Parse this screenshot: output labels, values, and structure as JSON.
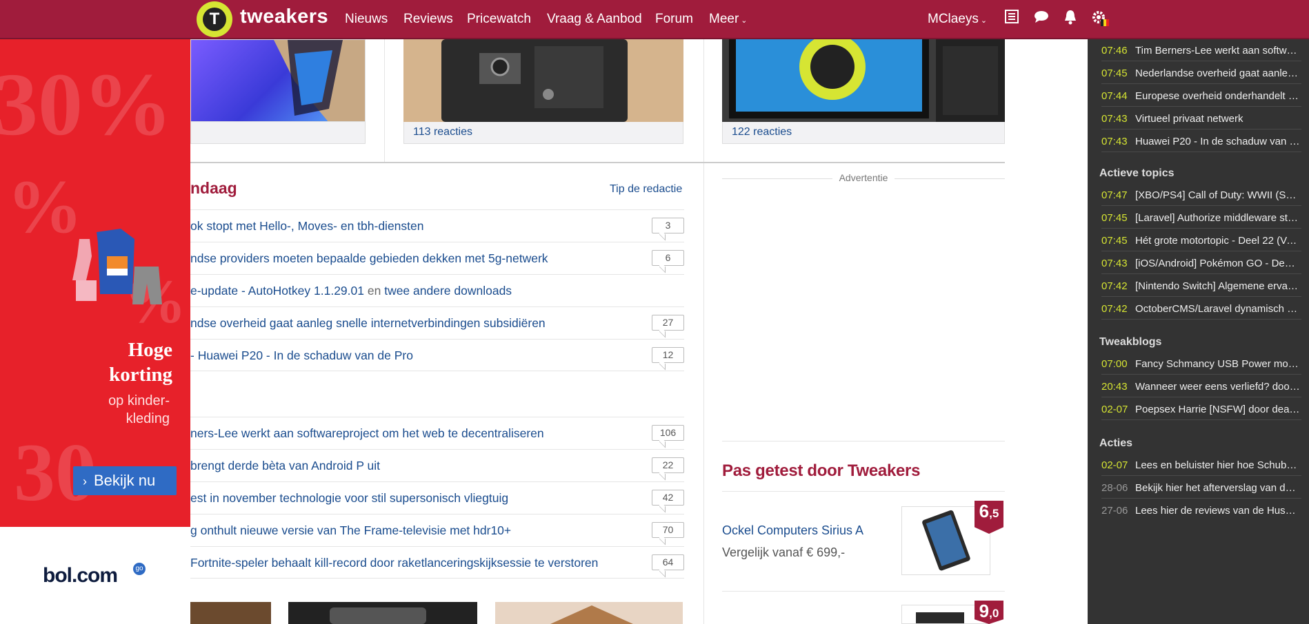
{
  "nav": {
    "logo_letter": "T",
    "logo_text": "tweakers",
    "links": [
      "Nieuws",
      "Reviews",
      "Pricewatch",
      "Vraag & Aanbod",
      "Forum",
      "Meer"
    ],
    "caret": "⌄",
    "user": "MClaeys",
    "icons": [
      "list-icon",
      "chat-icon",
      "bell-icon",
      "settings-flag-icon"
    ]
  },
  "ad": {
    "title_line1": "Hoge",
    "title_line2": "korting",
    "sub_line1": "op kinder-",
    "sub_line2": "kleding",
    "button_chevron": "›",
    "button": "Bekijk nu",
    "brand": "bol.com",
    "brand_badge": "go",
    "bg_text1": "30%",
    "bg_text2": "%",
    "bg_text3": "%",
    "bg_text4": "30"
  },
  "thumbs": [
    {
      "caption": ""
    },
    {
      "caption": "113 reacties"
    },
    {
      "caption": "122 reacties"
    }
  ],
  "section": {
    "title": "ndaag",
    "tip": "Tip de redactie"
  },
  "news_top": [
    {
      "title": "ok stopt met Hello-, Moves- en tbh-diensten",
      "count": "3"
    },
    {
      "title": "ndse providers moeten bepaalde gebieden dekken met 5g-netwerk",
      "count": "6"
    },
    {
      "title": "e-update - AutoHotkey 1.1.29.01",
      "sep": "en",
      "title2": "twee andere downloads",
      "count": ""
    },
    {
      "title": "ndse overheid gaat aanleg snelle internetverbindingen subsidiëren",
      "count": "27"
    },
    {
      "title": "- Huawei P20 - In de schaduw van de Pro",
      "count": "12"
    }
  ],
  "news_bottom": [
    {
      "title": "ners-Lee werkt aan softwareproject om het web te decentraliseren",
      "count": "106"
    },
    {
      "title": "brengt derde bèta van Android P uit",
      "count": "22"
    },
    {
      "title": "est in november technologie voor stil supersonisch vliegtuig",
      "count": "42"
    },
    {
      "title": "g onthult nieuwe versie van The Frame-televisie met hdr10+",
      "count": "70"
    },
    {
      "title": "Fortnite-speler behaalt kill-record door raketlanceringskijksessie te verstoren",
      "count": "64"
    }
  ],
  "middle": {
    "advertentie": "Advertentie",
    "tested_title": "Pas getest door Tweakers",
    "product_name": "Ockel Computers Sirius A",
    "product_price": "Vergelijk vanaf € 699,-",
    "score1_big": "6",
    "score1_small": ",5",
    "score2_big": "9",
    "score2_small": ",0"
  },
  "sidebar": {
    "latest": [
      {
        "time": "07:46",
        "text": "Tim Berners-Lee werkt aan softw…"
      },
      {
        "time": "07:45",
        "text": "Nederlandse overheid gaat aanleg…"
      },
      {
        "time": "07:44",
        "text": "Europese overheid onderhandelt …"
      },
      {
        "time": "07:43",
        "text": "Virtueel privaat netwerk"
      },
      {
        "time": "07:43",
        "text": "Huawei P20 - In de schaduw van …"
      }
    ],
    "topics_head": "Actieve topics",
    "topics": [
      {
        "time": "07:47",
        "text": "[XBO/PS4] Call of Duty: WWII (S…"
      },
      {
        "time": "07:45",
        "text": "[Laravel] Authorize middleware st…"
      },
      {
        "time": "07:45",
        "text": "Hét grote motortopic - Deel 22 (Ve…"
      },
      {
        "time": "07:43",
        "text": "[iOS/Android] Pokémon GO - Dee…"
      },
      {
        "time": "07:42",
        "text": "[Nintendo Switch] Algemene ervar…"
      },
      {
        "time": "07:42",
        "text": "OctoberCMS/Laravel dynamisch …"
      }
    ],
    "blogs_head": "Tweakblogs",
    "blogs": [
      {
        "time": "07:00",
        "text": "Fancy Schmancy USB Power mo…"
      },
      {
        "time": "20:43",
        "text": "Wanneer weer eens verliefd? doo…"
      },
      {
        "time": "02-07",
        "text": "Poepsex Harrie [NSFW] door dea…"
      }
    ],
    "actions_head": "Acties",
    "actions": [
      {
        "time": "02-07",
        "text": "Lees en beluister hier hoe Schub…"
      },
      {
        "time": "28-06",
        "text": "Bekijk hier het afterverslag van de…"
      },
      {
        "time": "27-06",
        "text": "Lees hier de reviews van de Husk…"
      }
    ]
  }
}
